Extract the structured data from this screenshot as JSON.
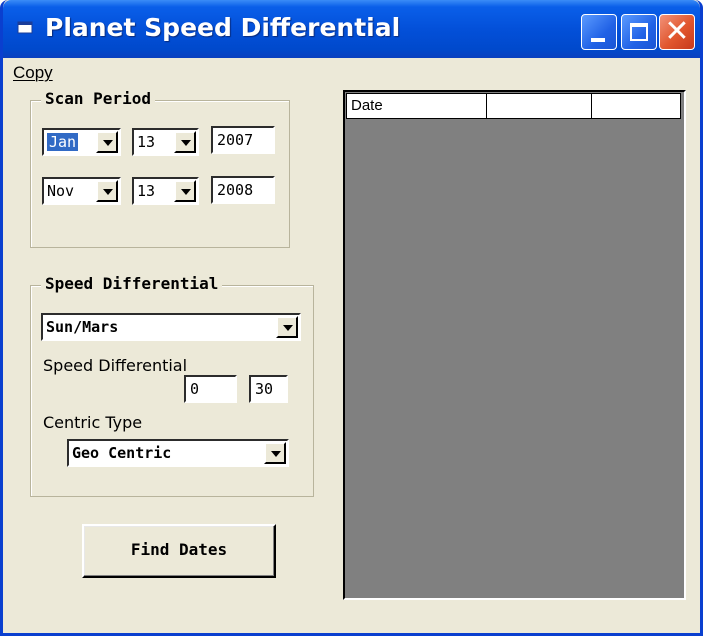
{
  "window": {
    "title": "Planet Speed Differential"
  },
  "menu": {
    "items": [
      "Copy"
    ]
  },
  "scan_period": {
    "title": "Scan Period",
    "start": {
      "month": "Jan",
      "day": "13",
      "year": "2007"
    },
    "end": {
      "month": "Nov",
      "day": "13",
      "year": "2008"
    }
  },
  "speed_differential": {
    "title": "Speed Differential",
    "planet_pair": "Sun/Mars",
    "speed_label": "Speed Differential",
    "speed_min": "0",
    "speed_max": "30",
    "centric_label": "Centric Type",
    "centric_value": "Geo Centric"
  },
  "actions": {
    "find_label": "Find Dates"
  },
  "results_grid": {
    "columns": [
      "Date",
      "",
      ""
    ],
    "rows": []
  },
  "colors": {
    "titlebar": "#0350d9",
    "window_bg": "#ece9d8",
    "grid_bg": "#808080",
    "selection": "#316ac5"
  }
}
